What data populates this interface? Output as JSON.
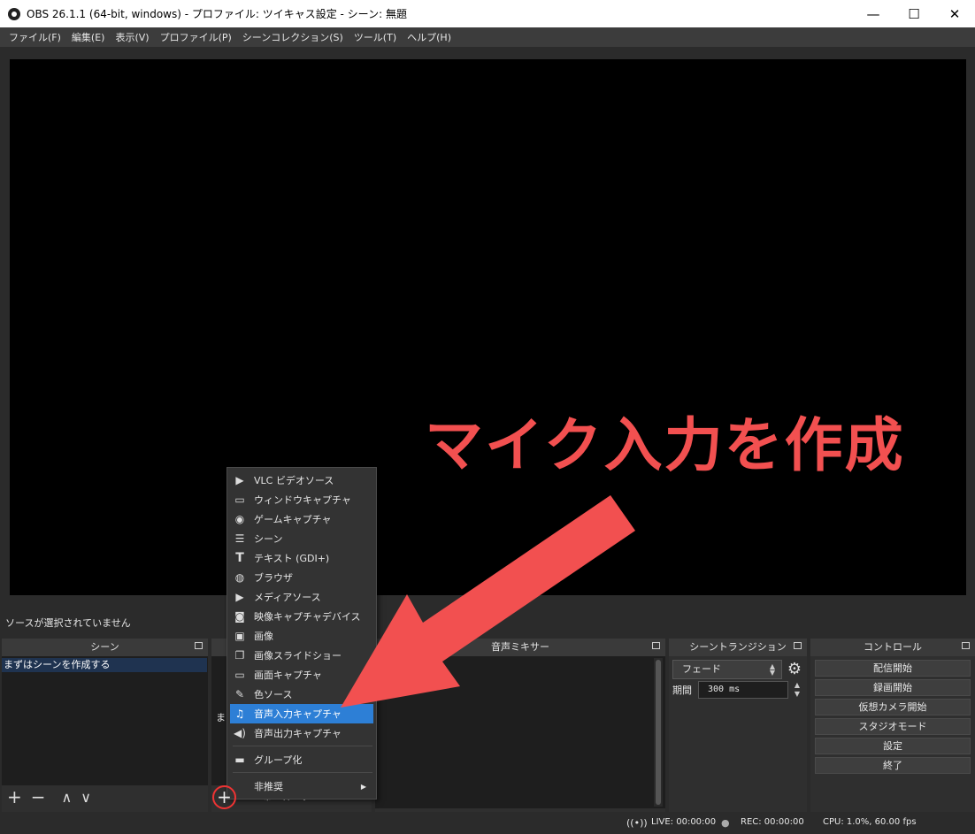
{
  "window": {
    "title": "OBS 26.1.1 (64-bit, windows) - プロファイル: ツイキャス設定 - シーン: 無題",
    "minimize": "—",
    "maximize": "☐",
    "close": "✕"
  },
  "menu": [
    "ファイル(F)",
    "編集(E)",
    "表示(V)",
    "プロファイル(P)",
    "シーンコレクション(S)",
    "ツール(T)",
    "ヘルプ(H)"
  ],
  "status_line": "ソースが選択されていません",
  "docks": {
    "scenes": {
      "title": "シーン",
      "items": [
        "まずはシーンを作成する"
      ]
    },
    "sources": {
      "title": "",
      "hint_fragment": "ま"
    },
    "mixer": {
      "title": "音声ミキサー"
    },
    "transitions": {
      "title": "シーントランジション",
      "selected": "フェード",
      "duration_label": "期間",
      "duration_value": "300 ms"
    },
    "controls": {
      "title": "コントロール",
      "buttons": [
        "配信開始",
        "録画開始",
        "仮想カメラ開始",
        "スタジオモード",
        "設定",
        "終了"
      ]
    }
  },
  "context_menu": {
    "items": [
      {
        "label": "VLC ビデオソース",
        "icon": "play-icon"
      },
      {
        "label": "ウィンドウキャプチャ",
        "icon": "window-icon"
      },
      {
        "label": "ゲームキャプチャ",
        "icon": "gamepad-icon"
      },
      {
        "label": "シーン",
        "icon": "list-icon"
      },
      {
        "label": "テキスト (GDI+)",
        "icon": "text-icon"
      },
      {
        "label": "ブラウザ",
        "icon": "globe-icon"
      },
      {
        "label": "メディアソース",
        "icon": "play-icon"
      },
      {
        "label": "映像キャプチャデバイス",
        "icon": "camera-icon"
      },
      {
        "label": "画像",
        "icon": "image-icon"
      },
      {
        "label": "画像スライドショー",
        "icon": "slideshow-icon"
      },
      {
        "label": "画面キャプチャ",
        "icon": "monitor-icon"
      },
      {
        "label": "色ソース",
        "icon": "brush-icon"
      },
      {
        "label": "音声入力キャプチャ",
        "icon": "microphone-icon",
        "active": true
      },
      {
        "label": "音声出力キャプチャ",
        "icon": "speaker-icon"
      },
      {
        "label": "グループ化",
        "icon": "folder-icon"
      },
      {
        "label": "非推奨",
        "icon": "submenu-arrow-icon"
      }
    ]
  },
  "annotation": {
    "text": "マイク入力を作成",
    "color": "#f25050",
    "highlight_color": "#e33333"
  },
  "statusbar": {
    "live": "LIVE: 00:00:00",
    "rec": "REC: 00:00:00",
    "cpu": "CPU: 1.0%, 60.00 fps"
  },
  "colors": {
    "accent_selected": "#2d7fd6",
    "background": "#2b2b2b",
    "preview": "#000000"
  }
}
